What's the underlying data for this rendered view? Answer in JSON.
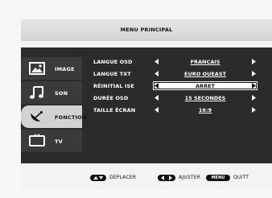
{
  "menu": {
    "title": "MENU PRINCIPAL"
  },
  "tabs": [
    {
      "id": "image",
      "label": "IMAGE",
      "icon": "picture-icon",
      "active": false
    },
    {
      "id": "son",
      "label": "SON",
      "icon": "music-note-icon",
      "active": false
    },
    {
      "id": "fonction",
      "label": "FONCTION",
      "icon": "satellite-dish-icon",
      "active": true
    },
    {
      "id": "tv",
      "label": "TV",
      "icon": "tv-icon",
      "active": false
    }
  ],
  "settings": [
    {
      "label": "LANGUE OSD",
      "value": "FRANCAIS"
    },
    {
      "label": "LANGUE TXT",
      "value": "EURO OUEAST"
    },
    {
      "label": "RÉINITIAL ISE",
      "value": "ARRET",
      "active": true
    },
    {
      "label": "DURÉE OSD",
      "value": "15 SECONDES"
    },
    {
      "label": "TAILLE ÉCRAN",
      "value": "16:9"
    }
  ],
  "footer": {
    "deplacer": "DÉPLACER",
    "ajuster": "AJUSTER",
    "menu_key": "MENU",
    "quit": "QUITT"
  },
  "colors": {
    "panel_dark": "#2b2b2b",
    "tab_active": "#d2d2d2",
    "selection": "#ffffff"
  }
}
